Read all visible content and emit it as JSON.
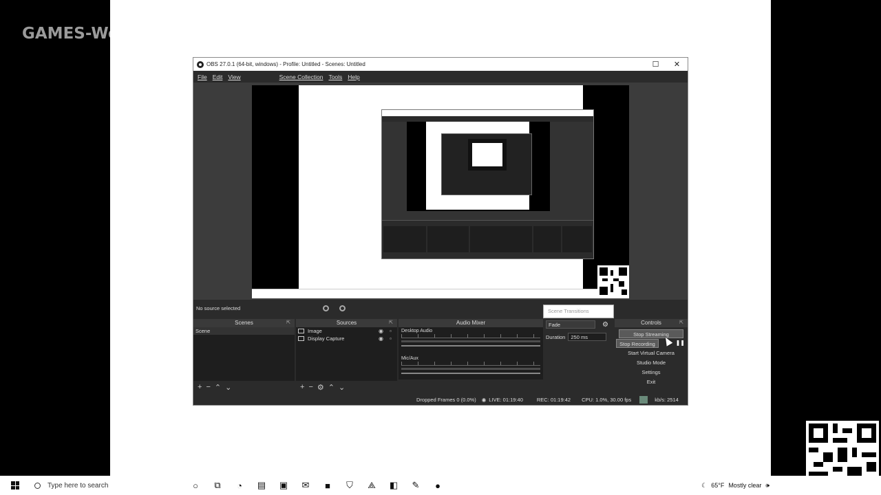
{
  "watermark": "GAMES-We",
  "obs": {
    "title": "OBS 27.0.1 (64-bit, windows) - Profile: Untitled - Scenes: Untitled",
    "window_buttons": {
      "maximize": "☐",
      "close": "✕"
    },
    "menu": [
      "File",
      "Edit",
      "View",
      "Scene Collection",
      "Tools",
      "Help"
    ],
    "source_status": "No source selected",
    "scene_transitions_popup": "Scene Transitions",
    "docks": {
      "scenes": {
        "title": "Scenes",
        "items": [
          "Scene"
        ]
      },
      "sources": {
        "title": "Sources",
        "items": [
          "Image",
          "Display Capture"
        ]
      },
      "mixer": {
        "title": "Audio Mixer",
        "channels": [
          "Desktop Audio",
          "Mic/Aux"
        ]
      },
      "transitions": {
        "type": "Fade",
        "duration_label": "Duration",
        "duration_value": "250 ms"
      },
      "controls": {
        "title": "Controls",
        "buttons": [
          "Stop Streaming",
          "Stop Recording",
          "Start Virtual Camera",
          "Studio Mode",
          "Settings",
          "Exit"
        ]
      }
    },
    "status": {
      "dropped": "Dropped Frames 0 (0.0%)",
      "live": "LIVE: 01:19:40",
      "rec": "REC: 01:19:42",
      "cpu": "CPU: 1.0%, 30.00 fps",
      "kbps": "kb/s: 2514"
    }
  },
  "taskbar": {
    "search_placeholder": "Type here to search",
    "weather_temp": "65°F",
    "weather_desc": "Mostly clear"
  }
}
